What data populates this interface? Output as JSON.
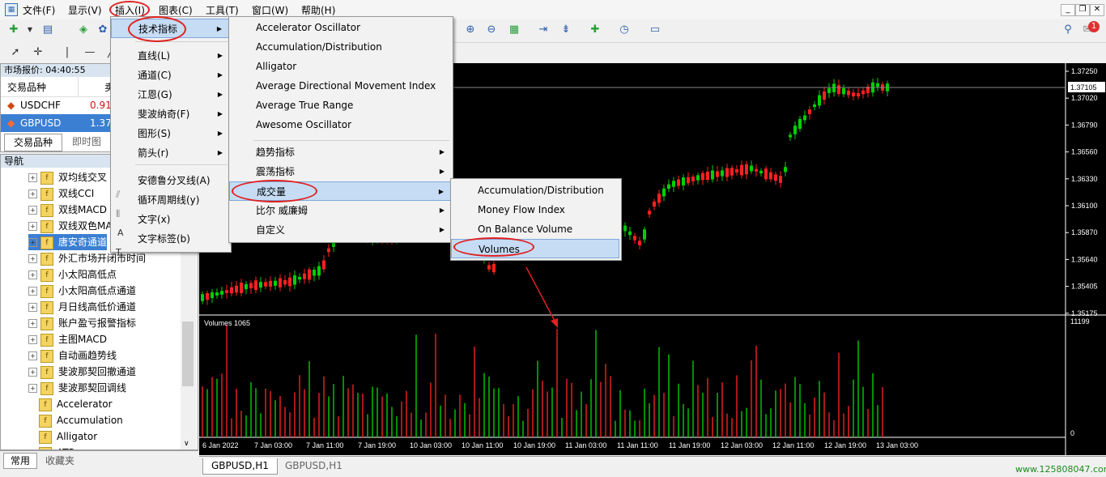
{
  "menubar": {
    "items": [
      "文件(F)",
      "显示(V)",
      "插入(I)",
      "图表(C)",
      "工具(T)",
      "窗口(W)",
      "帮助(H)"
    ]
  },
  "market_watch": {
    "title": "市场报价: 04:40:55",
    "col_symbol": "交易品种",
    "col_bid": "卖",
    "rows": [
      {
        "symbol": "USDCHF",
        "bid": "0.91"
      },
      {
        "symbol": "GBPUSD",
        "bid": "1.37"
      }
    ],
    "tabs": [
      "交易品种",
      "即时图"
    ]
  },
  "navigator": {
    "title": "导航",
    "items": [
      "双均线交叉",
      "双线CCI",
      "双线MACD",
      "双线双色MA",
      "唐安奇通道",
      "外汇市场开闭市时间",
      "小太阳高低点",
      "小太阳高低点通道",
      "月日线高低价通道",
      "账户盈亏报警指标",
      "主图MACD",
      "自动画趋势线",
      "斐波那契回撤通道",
      "斐波那契回调线",
      "Accelerator",
      "Accumulation",
      "Alligator",
      "ATR"
    ],
    "tabs": [
      "常用",
      "收藏夹"
    ]
  },
  "insert_menu": {
    "items": [
      {
        "label": "技术指标",
        "submenu": true
      },
      {
        "label": "直线(L)",
        "submenu": true
      },
      {
        "label": "通道(C)",
        "submenu": true
      },
      {
        "label": "江恩(G)",
        "submenu": true
      },
      {
        "label": "斐波纳奇(F)",
        "submenu": true
      },
      {
        "label": "图形(S)",
        "submenu": true
      },
      {
        "label": "箭头(r)",
        "submenu": true
      },
      {
        "label": "安德鲁分叉线(A)",
        "submenu": false
      },
      {
        "label": "循环周期线(y)",
        "submenu": false
      },
      {
        "label": "文字(x)",
        "submenu": false
      },
      {
        "label": "文字标签(b)",
        "submenu": false
      }
    ]
  },
  "indicators_menu": {
    "items": [
      "Accelerator Oscillator",
      "Accumulation/Distribution",
      "Alligator",
      "Average Directional Movement Index",
      "Average True Range",
      "Awesome Oscillator"
    ],
    "groups": [
      "趋势指标",
      "震荡指标",
      "成交量",
      "比尔 威廉姆",
      "自定义"
    ]
  },
  "volume_menu": {
    "items": [
      "Accumulation/Distribution",
      "Money Flow Index",
      "On Balance Volume",
      "Volumes"
    ]
  },
  "chart": {
    "current_price": "1.37105",
    "price_ticks": [
      "1.37250",
      "1.37020",
      "1.36790",
      "1.36560",
      "1.36330",
      "1.36100",
      "1.35870",
      "1.35640",
      "1.35405",
      "1.35175"
    ],
    "volume_label": "Volumes 1065",
    "volume_max": "11199",
    "volume_min": "0",
    "time_ticks": [
      "6 Jan 2022",
      "7 Jan 03:00",
      "7 Jan 11:00",
      "7 Jan 19:00",
      "10 Jan 03:00",
      "10 Jan 11:00",
      "10 Jan 19:00",
      "11 Jan 03:00",
      "11 Jan 11:00",
      "11 Jan 19:00",
      "12 Jan 03:00",
      "12 Jan 11:00",
      "12 Jan 19:00",
      "13 Jan 03:00"
    ]
  },
  "chart_tabs": [
    "GBPUSD,H1",
    "GBPUSD,H1"
  ],
  "watermark": "www.125808047.com",
  "notification_count": "1"
}
